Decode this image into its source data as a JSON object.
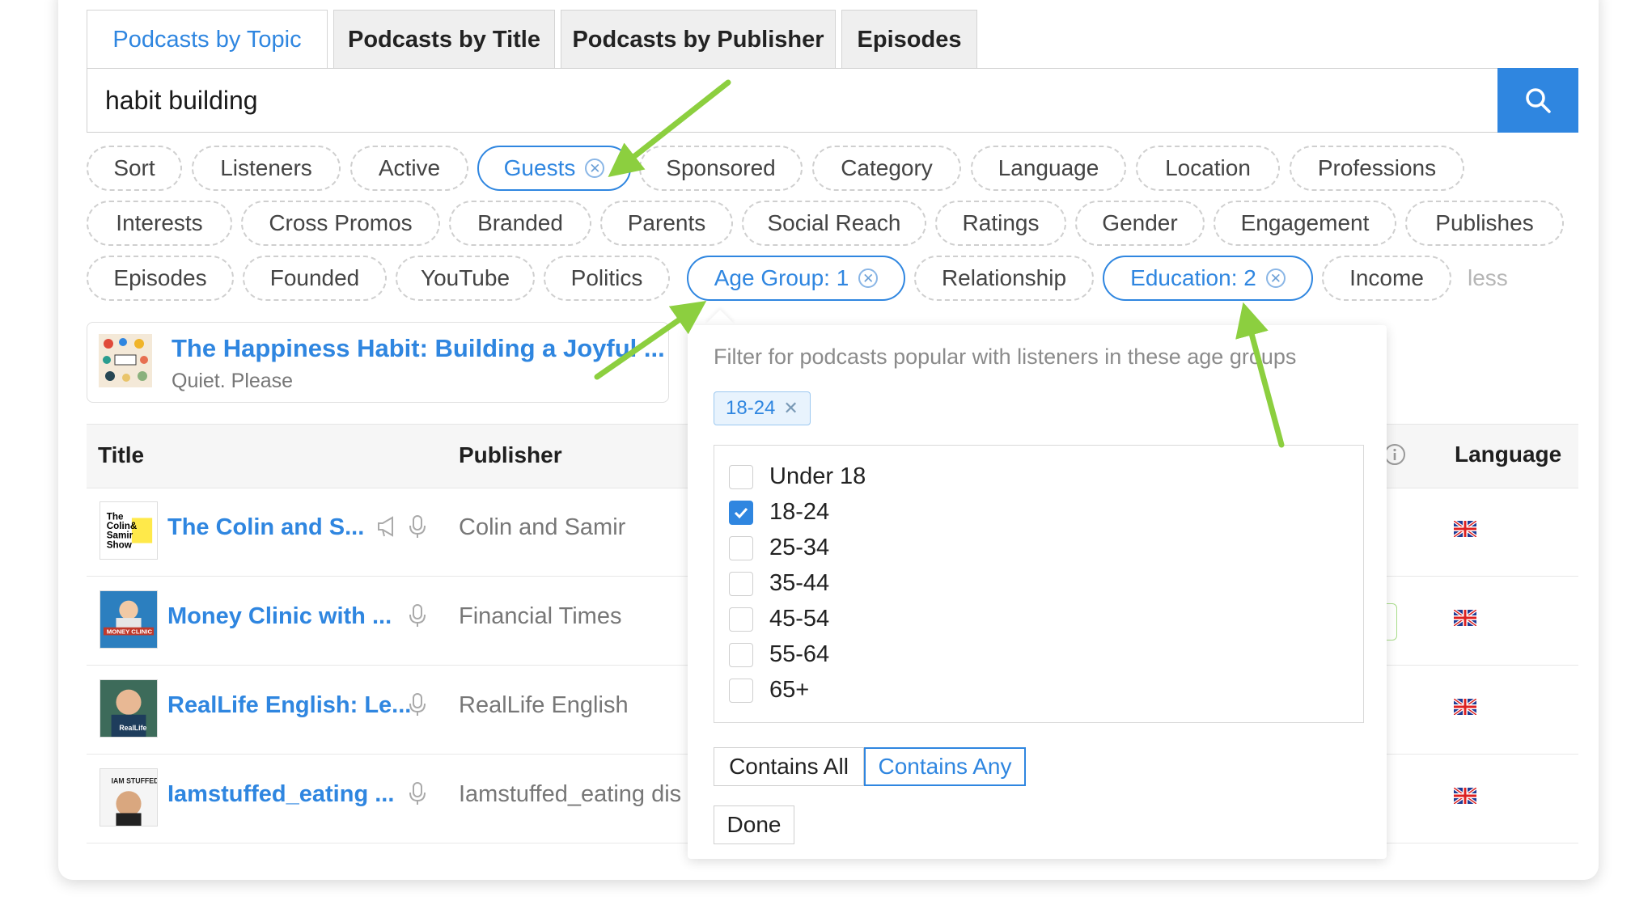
{
  "tabs": [
    {
      "label": "Podcasts by Topic",
      "active": true
    },
    {
      "label": "Podcasts by Title"
    },
    {
      "label": "Podcasts by Publisher"
    },
    {
      "label": "Episodes"
    }
  ],
  "search": {
    "value": "habit building",
    "button_icon": "search-icon"
  },
  "filters": {
    "row1": [
      "Sort",
      "Listeners",
      "Active",
      "Guests",
      "Sponsored",
      "Category",
      "Language",
      "Location",
      "Professions"
    ],
    "row2": [
      "Interests",
      "Cross Promos",
      "Branded",
      "Parents",
      "Social Reach",
      "Ratings",
      "Gender",
      "Engagement",
      "Publishes"
    ],
    "row3": [
      "Episodes",
      "Founded",
      "YouTube",
      "Politics",
      "Age Group: 1",
      "Relationship",
      "Education: 2",
      "Income"
    ],
    "less_label": "less"
  },
  "featured": {
    "title": "The Happiness Habit: Building a Joyful ...",
    "publisher": "Quiet. Please"
  },
  "table": {
    "headers": {
      "title": "Title",
      "publisher": "Publisher",
      "language": "Language"
    },
    "rows": [
      {
        "title": "The Colin and S...",
        "publisher": "Colin and Samir",
        "thumb_text": "The Colin & Samir Show"
      },
      {
        "title": "Money Clinic with ...",
        "publisher": "Financial Times",
        "thumb_text": "MONEY CLINIC"
      },
      {
        "title": "RealLife English: Le...",
        "publisher": "RealLife English",
        "thumb_text": "RealLife"
      },
      {
        "title": "Iamstuffed_eating ...",
        "publisher": "Iamstuffed_eating dis",
        "thumb_text": "IAM STUFFED"
      }
    ]
  },
  "popover": {
    "description": "Filter for podcasts popular with listeners in these age groups",
    "selected_tag": "18-24",
    "options": [
      {
        "label": "Under 18",
        "checked": false
      },
      {
        "label": "18-24",
        "checked": true
      },
      {
        "label": "25-34",
        "checked": false
      },
      {
        "label": "35-44",
        "checked": false
      },
      {
        "label": "45-54",
        "checked": false
      },
      {
        "label": "55-64",
        "checked": false
      },
      {
        "label": "65+",
        "checked": false
      }
    ],
    "match_all": "Contains All",
    "match_any": "Contains Any",
    "done": "Done"
  },
  "colors": {
    "accent": "#2f86e0",
    "arrow": "#8ccf3f"
  }
}
